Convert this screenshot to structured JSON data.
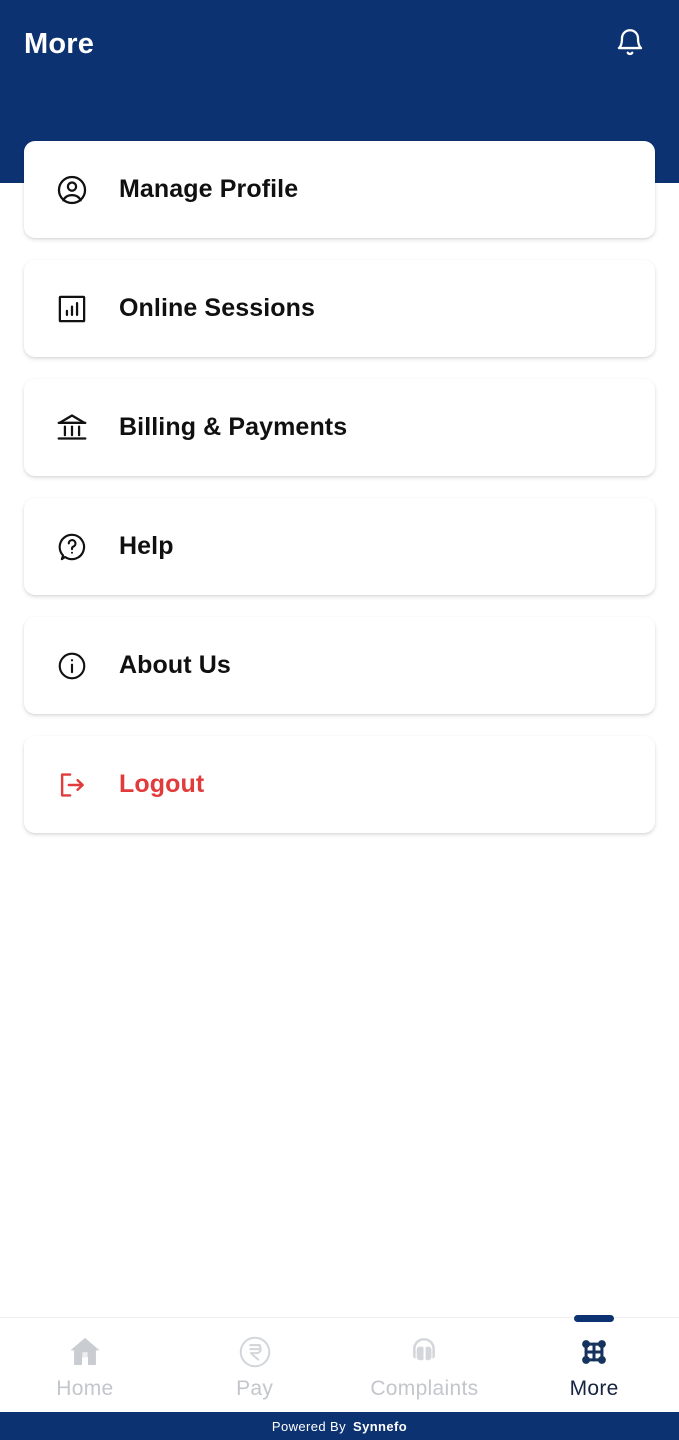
{
  "header": {
    "title": "More",
    "notification_icon": "bell-icon",
    "background_color": "#0d3271"
  },
  "menu": {
    "items": [
      {
        "label": "Manage Profile",
        "icon": "user-circle-icon",
        "color": "#101010"
      },
      {
        "label": "Online Sessions",
        "icon": "bar-chart-box-icon",
        "color": "#101010"
      },
      {
        "label": "Billing & Payments",
        "icon": "bank-icon",
        "color": "#101010"
      },
      {
        "label": "Help",
        "icon": "question-bubble-icon",
        "color": "#101010"
      },
      {
        "label": "About Us",
        "icon": "info-circle-icon",
        "color": "#101010"
      },
      {
        "label": "Logout",
        "icon": "logout-icon",
        "color": "#e23b3b"
      }
    ]
  },
  "bottom_nav": {
    "active": "More",
    "items": [
      {
        "label": "Home",
        "icon": "home-icon",
        "active": false
      },
      {
        "label": "Pay",
        "icon": "rupee-circle-icon",
        "active": false
      },
      {
        "label": "Complaints",
        "icon": "headset-icon",
        "active": false
      },
      {
        "label": "More",
        "icon": "grid-nodes-icon",
        "active": true
      }
    ],
    "inactive_color": "#c3c6ca",
    "active_color": "#16243f"
  },
  "footer": {
    "prefix": "Powered By",
    "brand": "Synnefo"
  }
}
